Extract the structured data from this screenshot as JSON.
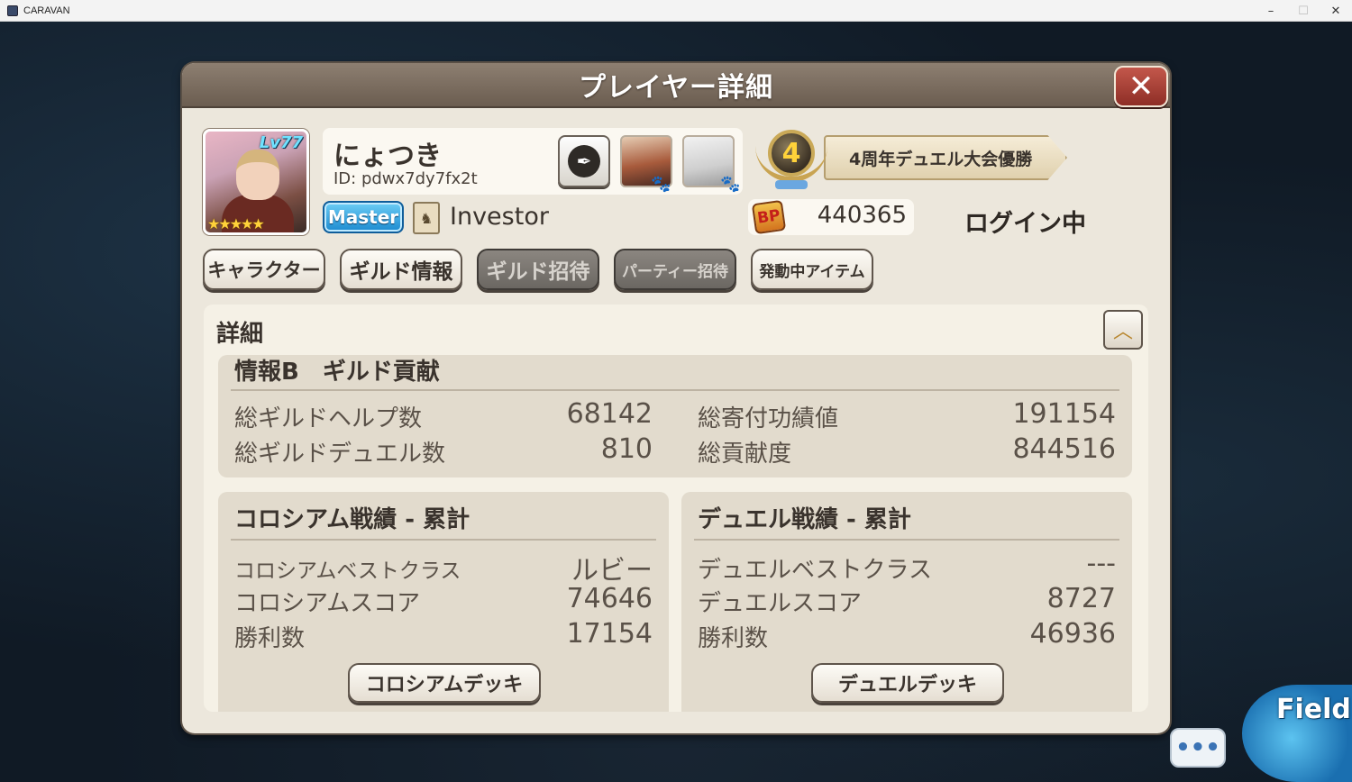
{
  "window": {
    "title": "CARAVAN",
    "minimize_glyph": "–",
    "maximize_glyph": "☐",
    "close_glyph": "✕"
  },
  "dialog": {
    "title": "プレイヤー詳細",
    "close_glyph": "✕"
  },
  "player": {
    "level": "Lv77",
    "stars": "★★★★★",
    "name": "にょつき",
    "id": "ID: pdwx7dy7fx2t",
    "class_badge": "Master",
    "guild_role": "Investor",
    "bp_icon": "BP",
    "bp_value": "440365",
    "status": "ログイン中",
    "title_badge_number": "4",
    "title_text": "4周年デュエル大会優勝"
  },
  "actions": {
    "character": "キャラクター",
    "guild_info": "ギルド情報",
    "guild_invite": "ギルド招待",
    "party_invite": "パーティー招待",
    "active_items": "発動中アイテム"
  },
  "details": {
    "heading": "詳細",
    "collapse_glyph": "︿",
    "guild_section": {
      "title": "情報B　ギルド貢献",
      "rows": [
        {
          "label": "総ギルドヘルプ数",
          "value": "68142"
        },
        {
          "label": "総ギルドデュエル数",
          "value": "810"
        },
        {
          "label": "総寄付功績値",
          "value": "191154"
        },
        {
          "label": "総貢献度",
          "value": "844516"
        }
      ]
    },
    "colosseum": {
      "title": "コロシアム戦績 - 累計",
      "best_class_label": "コロシアムベストクラス",
      "best_class_value": "ルビー",
      "score_label": "コロシアムスコア",
      "score_value": "74646",
      "wins_label": "勝利数",
      "wins_value": "17154",
      "deck_button": "コロシアムデッキ"
    },
    "duel": {
      "title": "デュエル戦績 - 累計",
      "best_class_label": "デュエルベストクラス",
      "best_class_value": "---",
      "score_label": "デュエルスコア",
      "score_value": "8727",
      "wins_label": "勝利数",
      "wins_value": "46936",
      "deck_button": "デュエルデッキ"
    }
  },
  "hud": {
    "chat_glyph": "•••",
    "field_label": "Field"
  }
}
